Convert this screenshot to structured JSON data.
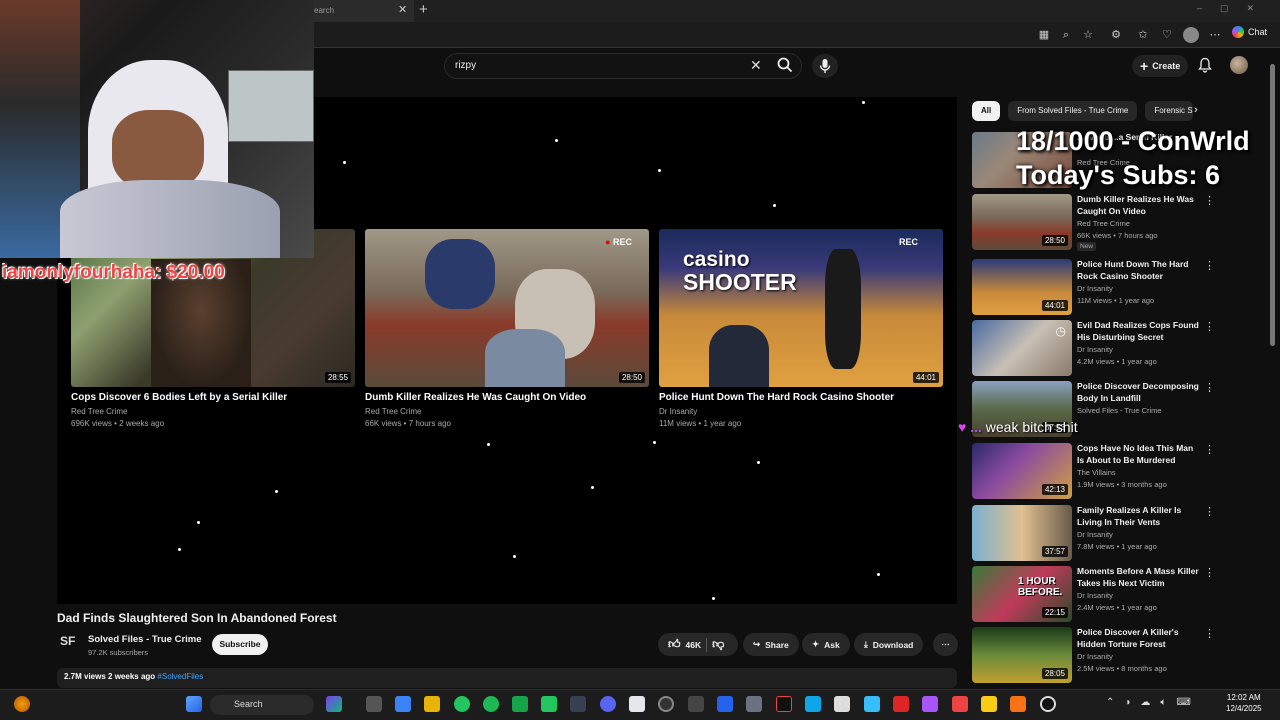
{
  "browser": {
    "tab_title": "earch",
    "chat_label": "Chat"
  },
  "youtube": {
    "search_value": "rizpy",
    "create_label": "Create"
  },
  "player": {
    "endcards": [
      {
        "title": "Cops Discover 6 Bodies Left by a Serial Killer",
        "channel": "Red Tree Crime",
        "meta": "696K views • 2 weeks ago",
        "duration": "28:55"
      },
      {
        "title": "Dumb Killer Realizes He Was Caught On Video",
        "channel": "Red Tree Crime",
        "meta": "66K views • 7 hours ago",
        "duration": "28:50",
        "rec_label": "REC"
      },
      {
        "title": "Police Hunt Down The Hard Rock Casino Shooter",
        "channel": "Dr Insanity",
        "meta": "11M views • 1 year ago",
        "duration": "44:01",
        "overlay_line1": "casino",
        "overlay_line2": "SHOOTER",
        "rec_label": "REC"
      }
    ]
  },
  "video": {
    "title": "Dad Finds Slaughtered Son In Abandoned Forest",
    "channel_logo": "SF",
    "channel_name": "Solved Files - True Crime",
    "subscribers": "97.2K subscribers",
    "subscribe_label": "Subscribe",
    "likes": "46K",
    "share_label": "Share",
    "ask_label": "Ask",
    "download_label": "Download",
    "views_date": "2.7M views  2 weeks ago",
    "hashtag": "#SolvedFiles"
  },
  "sidebar": {
    "chips": [
      "All",
      "From Solved Files - True Crime",
      "Forensic S"
    ],
    "items": [
      {
        "title": "...over 6 ...a Serial Killer",
        "channel": "Red Tree Crime",
        "meta": "...",
        "duration": ""
      },
      {
        "title": "Dumb Killer Realizes He Was Caught On Video",
        "channel": "Red Tree Crime",
        "meta": "66K views • 7 hours ago",
        "duration": "28:50",
        "badge": "New"
      },
      {
        "title": "Police Hunt Down The Hard Rock Casino Shooter",
        "channel": "Dr Insanity",
        "meta": "11M views • 1 year ago",
        "duration": "44:01"
      },
      {
        "title": "Evil Dad Realizes Cops Found His Disturbing Secret",
        "channel": "Dr Insanity",
        "meta": "4.2M views • 1 year ago",
        "duration": ""
      },
      {
        "title": "Police Discover Decomposing Body In Landfill",
        "channel": "Solved Files - True Crime",
        "meta": "",
        "duration": "37:53"
      },
      {
        "title": "Cops Have No Idea This Man Is About to Be Murdered",
        "channel": "The Villains",
        "meta": "1.9M views • 3 months ago",
        "duration": "42:13"
      },
      {
        "title": "Family Realizes A Killer Is Living In Their Vents",
        "channel": "Dr Insanity",
        "meta": "7.8M views • 1 year ago",
        "duration": "37:57"
      },
      {
        "title": "Moments Before A Mass Killer Takes His Next Victim",
        "channel": "Dr Insanity",
        "meta": "2.4M views • 1 year ago",
        "duration": "22:15",
        "overlay": "1 HOUR BEFORE."
      },
      {
        "title": "Police Discover A Killer's Hidden Torture Forest",
        "channel": "Dr Insanity",
        "meta": "2.5M views • 8 months ago",
        "duration": "28:05"
      }
    ]
  },
  "overlays": {
    "donation": "iamonlyfourhaha: $20.00",
    "goal_line1": "18/1000 - ConWrld",
    "goal_line2": "Today's Subs: 6",
    "chat_user": "...",
    "chat_text": "weak bitch shit"
  },
  "taskbar": {
    "search_label": "Search",
    "time": "12:02 AM",
    "date": "12/4/2025"
  }
}
